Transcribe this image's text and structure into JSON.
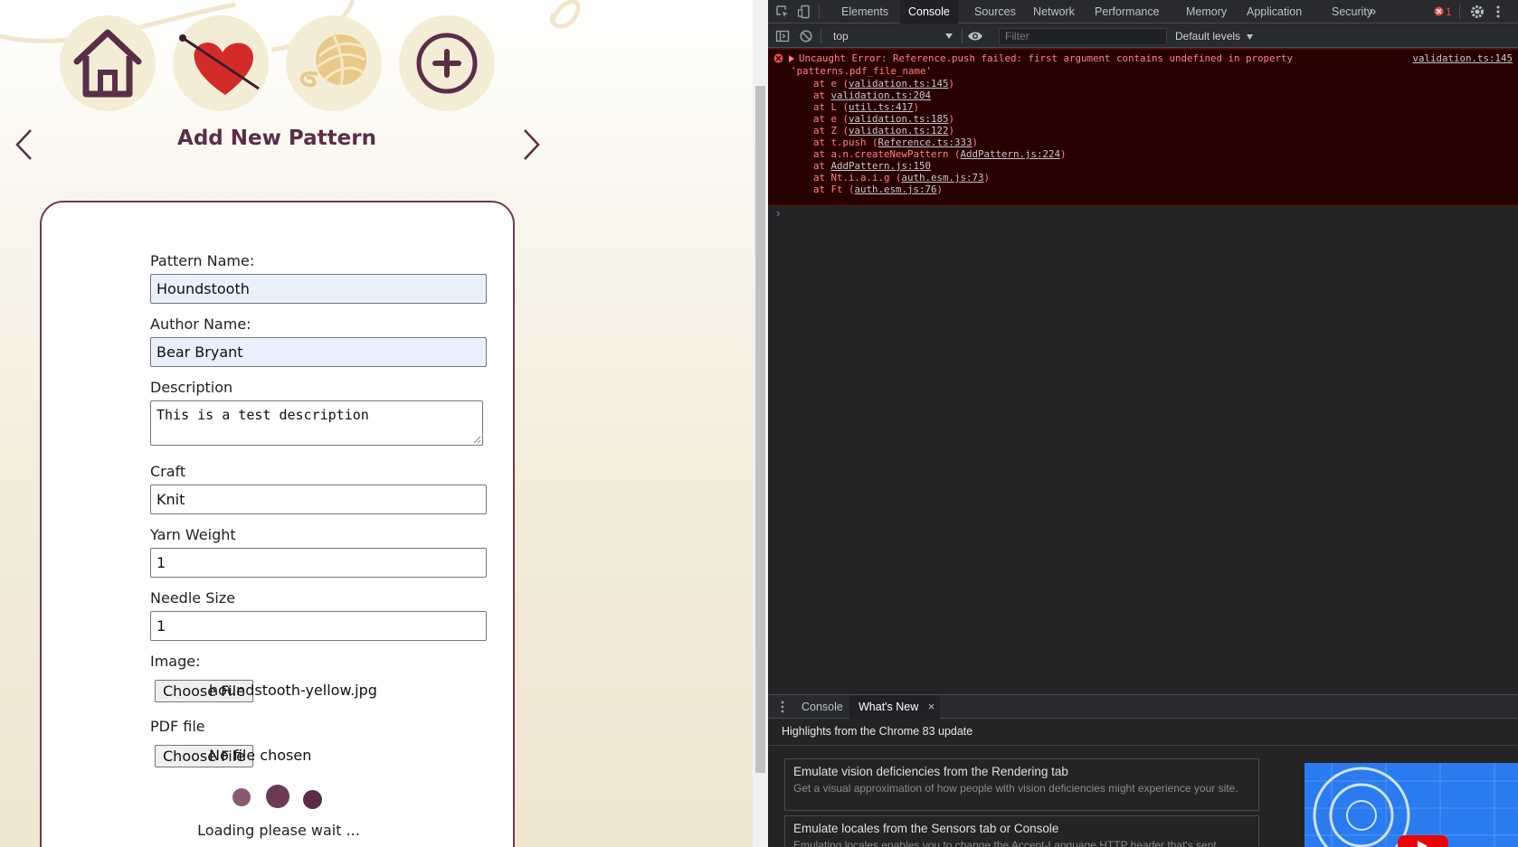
{
  "app": {
    "nav": [
      {
        "name": "home",
        "icon": "house-icon"
      },
      {
        "name": "favorites",
        "icon": "heart-needle-icon"
      },
      {
        "name": "yarn",
        "icon": "yarn-ball-icon"
      },
      {
        "name": "add",
        "icon": "plus-circle-icon"
      }
    ],
    "title": "Add New Pattern",
    "form": {
      "pattern_name_label": "Pattern Name:",
      "pattern_name_value": "Houndstooth",
      "author_label": "Author Name:",
      "author_value": "Bear Bryant",
      "description_label": "Description",
      "description_value": "This is a test description",
      "craft_label": "Craft",
      "craft_value": "Knit",
      "yarn_weight_label": "Yarn Weight",
      "yarn_weight_value": "1",
      "needle_size_label": "Needle Size",
      "needle_size_value": "1",
      "image_label": "Image:",
      "image_button": "Choose File",
      "image_file": "houndstooth-yellow.jpg",
      "pdf_label": "PDF file",
      "pdf_button": "Choose File",
      "pdf_file": "No file chosen",
      "loading_text": "Loading please wait ..."
    },
    "colors": {
      "accent": "#5a2e48",
      "circle": "#f4edd6",
      "gold": "#e8c98a",
      "heart": "#d42a2a"
    }
  },
  "devtools": {
    "tabs": [
      "Elements",
      "Console",
      "Sources",
      "Network",
      "Performance",
      "Memory",
      "Application",
      "Security"
    ],
    "active_tab": "Console",
    "more_tabs": "»",
    "error_count": "1",
    "context": "top",
    "filter_placeholder": "Filter",
    "levels": "Default levels",
    "error": {
      "line1": "Uncaught Error: Reference.push failed: first argument contains undefined in property",
      "line2": "'patterns.pdf_file_name'",
      "source": "validation.ts:145",
      "stack": [
        {
          "prefix": "at e (",
          "link": "validation.ts:145",
          "suffix": ")"
        },
        {
          "prefix": "at ",
          "link": "validation.ts:204",
          "suffix": ""
        },
        {
          "prefix": "at L (",
          "link": "util.ts:417",
          "suffix": ")"
        },
        {
          "prefix": "at e (",
          "link": "validation.ts:185",
          "suffix": ")"
        },
        {
          "prefix": "at Z (",
          "link": "validation.ts:122",
          "suffix": ")"
        },
        {
          "prefix": "at t.push (",
          "link": "Reference.ts:333",
          "suffix": ")"
        },
        {
          "prefix": "at a.n.createNewPattern (",
          "link": "AddPattern.js:224",
          "suffix": ")"
        },
        {
          "prefix": "at ",
          "link": "AddPattern.js:150",
          "suffix": ""
        },
        {
          "prefix": "at Nt.i.a.i.g (",
          "link": "auth.esm.js:73",
          "suffix": ")"
        },
        {
          "prefix": "at Ft (",
          "link": "auth.esm.js:76",
          "suffix": ")"
        }
      ]
    },
    "prompt": "›",
    "drawer": {
      "tabs": [
        "Console",
        "What's New"
      ],
      "active_tab": "What's New",
      "close": "×",
      "highlights": "Highlights from the Chrome 83 update",
      "cards": [
        {
          "title": "Emulate vision deficiencies from the Rendering tab",
          "desc": "Get a visual approximation of how people with vision deficiencies might experience your site."
        },
        {
          "title": "Emulate locales from the Sensors tab or Console",
          "desc": "Emulating locales enables you to change the Accept-Language HTTP header that's sent"
        }
      ]
    }
  }
}
